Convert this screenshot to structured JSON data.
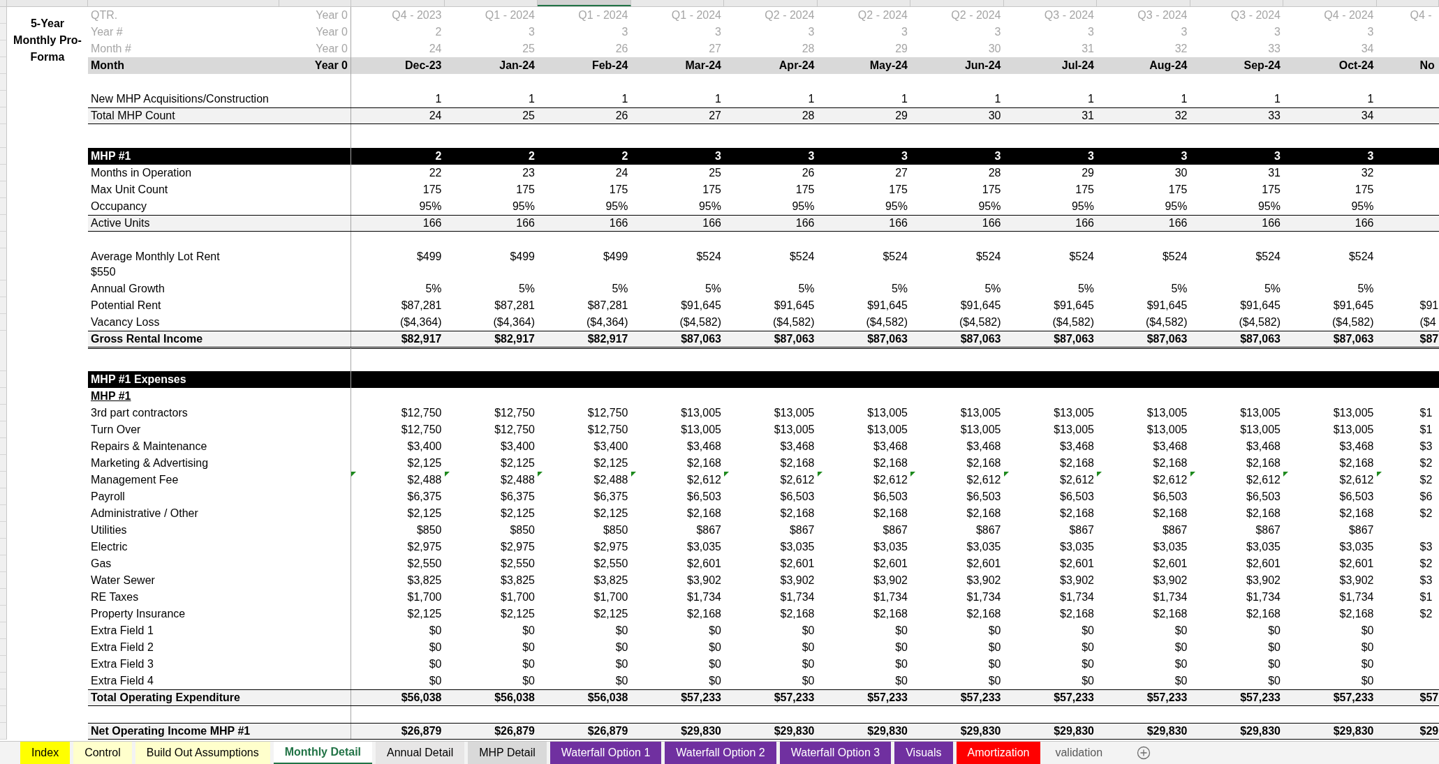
{
  "title_block": "5-Year Monthly Pro-Forma",
  "columns": [
    {
      "selected": false
    },
    {
      "selected": false
    },
    {
      "selected": true
    },
    {
      "selected": false
    },
    {
      "selected": false
    },
    {
      "selected": false
    },
    {
      "selected": false
    },
    {
      "selected": false
    },
    {
      "selected": false
    },
    {
      "selected": false
    },
    {
      "selected": false
    },
    {
      "selected": false
    }
  ],
  "header_rows": [
    {
      "kind": "muted",
      "label": "QTR.",
      "year0": "Year 0",
      "values": [
        "Q4 - 2023",
        "Q1 - 2024",
        "Q1 - 2024",
        "Q1 - 2024",
        "Q2 - 2024",
        "Q2 - 2024",
        "Q2 - 2024",
        "Q3 - 2024",
        "Q3 - 2024",
        "Q3 - 2024",
        "Q4 - 2024"
      ],
      "edge": "Q4 -"
    },
    {
      "kind": "muted",
      "label": "Year #",
      "year0": "Year 0",
      "values": [
        "2",
        "3",
        "3",
        "3",
        "3",
        "3",
        "3",
        "3",
        "3",
        "3",
        "3"
      ]
    },
    {
      "kind": "muted",
      "label": "Month #",
      "year0": "Year 0",
      "values": [
        "24",
        "25",
        "26",
        "27",
        "28",
        "29",
        "30",
        "31",
        "32",
        "33",
        "34"
      ]
    },
    {
      "kind": "heading",
      "label": "Month",
      "year0": "Year 0",
      "values": [
        "Dec-23",
        "Jan-24",
        "Feb-24",
        "Mar-24",
        "Apr-24",
        "May-24",
        "Jun-24",
        "Jul-24",
        "Aug-24",
        "Sep-24",
        "Oct-24"
      ],
      "edge": "No"
    }
  ],
  "rows": [
    {
      "kind": "spacer"
    },
    {
      "kind": "plain",
      "label": "New MHP Acquisitions/Construction",
      "values": [
        "1",
        "1",
        "1",
        "1",
        "1",
        "1",
        "1",
        "1",
        "1",
        "1",
        "1"
      ]
    },
    {
      "kind": "total",
      "label": "Total MHP Count",
      "values": [
        "24",
        "25",
        "26",
        "27",
        "28",
        "29",
        "30",
        "31",
        "32",
        "33",
        "34"
      ]
    },
    {
      "kind": "spacer"
    },
    {
      "kind": "band",
      "label": "MHP #1",
      "values": [
        "2",
        "2",
        "2",
        "3",
        "3",
        "3",
        "3",
        "3",
        "3",
        "3",
        "3"
      ]
    },
    {
      "kind": "plain",
      "label": "Months in Operation",
      "values": [
        "22",
        "23",
        "24",
        "25",
        "26",
        "27",
        "28",
        "29",
        "30",
        "31",
        "32"
      ]
    },
    {
      "kind": "plain",
      "label": "Max Unit Count",
      "values": [
        "175",
        "175",
        "175",
        "175",
        "175",
        "175",
        "175",
        "175",
        "175",
        "175",
        "175"
      ]
    },
    {
      "kind": "plain",
      "label": "Occupancy",
      "values": [
        "95%",
        "95%",
        "95%",
        "95%",
        "95%",
        "95%",
        "95%",
        "95%",
        "95%",
        "95%",
        "95%"
      ]
    },
    {
      "kind": "total",
      "label": "Active Units",
      "values": [
        "166",
        "166",
        "166",
        "166",
        "166",
        "166",
        "166",
        "166",
        "166",
        "166",
        "166"
      ]
    },
    {
      "kind": "spacer"
    },
    {
      "kind": "plain",
      "label": "Average Monthly Lot Rent",
      "note": "$550",
      "values": [
        "$499",
        "$499",
        "$499",
        "$524",
        "$524",
        "$524",
        "$524",
        "$524",
        "$524",
        "$524",
        "$524"
      ]
    },
    {
      "kind": "plain",
      "label": "Annual Growth",
      "values": [
        "5%",
        "5%",
        "5%",
        "5%",
        "5%",
        "5%",
        "5%",
        "5%",
        "5%",
        "5%",
        "5%"
      ]
    },
    {
      "kind": "plain",
      "label": "Potential Rent",
      "values": [
        "$87,281",
        "$87,281",
        "$87,281",
        "$91,645",
        "$91,645",
        "$91,645",
        "$91,645",
        "$91,645",
        "$91,645",
        "$91,645",
        "$91,645"
      ],
      "edge": "$91"
    },
    {
      "kind": "plain",
      "label": "Vacancy Loss",
      "values": [
        "($4,364)",
        "($4,364)",
        "($4,364)",
        "($4,582)",
        "($4,582)",
        "($4,582)",
        "($4,582)",
        "($4,582)",
        "($4,582)",
        "($4,582)",
        "($4,582)"
      ],
      "edge": "($4"
    },
    {
      "kind": "grand",
      "label": "Gross Rental Income",
      "values": [
        "$82,917",
        "$82,917",
        "$82,917",
        "$87,063",
        "$87,063",
        "$87,063",
        "$87,063",
        "$87,063",
        "$87,063",
        "$87,063",
        "$87,063"
      ],
      "edge": "$87"
    },
    {
      "kind": "spacer"
    },
    {
      "kind": "band",
      "label": "MHP #1 Expenses",
      "values": []
    },
    {
      "kind": "subhead",
      "label": "MHP #1",
      "values": []
    },
    {
      "kind": "plain",
      "label": "3rd part contractors",
      "values": [
        "$12,750",
        "$12,750",
        "$12,750",
        "$13,005",
        "$13,005",
        "$13,005",
        "$13,005",
        "$13,005",
        "$13,005",
        "$13,005",
        "$13,005"
      ],
      "edge": "$1"
    },
    {
      "kind": "plain",
      "label": "Turn Over",
      "values": [
        "$12,750",
        "$12,750",
        "$12,750",
        "$13,005",
        "$13,005",
        "$13,005",
        "$13,005",
        "$13,005",
        "$13,005",
        "$13,005",
        "$13,005"
      ],
      "edge": "$1"
    },
    {
      "kind": "plain",
      "label": "Repairs & Maintenance",
      "values": [
        "$3,400",
        "$3,400",
        "$3,400",
        "$3,468",
        "$3,468",
        "$3,468",
        "$3,468",
        "$3,468",
        "$3,468",
        "$3,468",
        "$3,468"
      ],
      "edge": "$3"
    },
    {
      "kind": "plain",
      "label": "Marketing & Advertising",
      "values": [
        "$2,125",
        "$2,125",
        "$2,125",
        "$2,168",
        "$2,168",
        "$2,168",
        "$2,168",
        "$2,168",
        "$2,168",
        "$2,168",
        "$2,168"
      ],
      "edge": "$2"
    },
    {
      "kind": "plain",
      "label": "Management Fee",
      "flagged": true,
      "values": [
        "$2,488",
        "$2,488",
        "$2,488",
        "$2,612",
        "$2,612",
        "$2,612",
        "$2,612",
        "$2,612",
        "$2,612",
        "$2,612",
        "$2,612"
      ],
      "edge": "$2"
    },
    {
      "kind": "plain",
      "label": "Payroll",
      "values": [
        "$6,375",
        "$6,375",
        "$6,375",
        "$6,503",
        "$6,503",
        "$6,503",
        "$6,503",
        "$6,503",
        "$6,503",
        "$6,503",
        "$6,503"
      ],
      "edge": "$6"
    },
    {
      "kind": "plain",
      "label": "Administrative / Other",
      "values": [
        "$2,125",
        "$2,125",
        "$2,125",
        "$2,168",
        "$2,168",
        "$2,168",
        "$2,168",
        "$2,168",
        "$2,168",
        "$2,168",
        "$2,168"
      ],
      "edge": "$2"
    },
    {
      "kind": "plain",
      "label": "Utilities",
      "values": [
        "$850",
        "$850",
        "$850",
        "$867",
        "$867",
        "$867",
        "$867",
        "$867",
        "$867",
        "$867",
        "$867"
      ]
    },
    {
      "kind": "plain",
      "label": "Electric",
      "values": [
        "$2,975",
        "$2,975",
        "$2,975",
        "$3,035",
        "$3,035",
        "$3,035",
        "$3,035",
        "$3,035",
        "$3,035",
        "$3,035",
        "$3,035"
      ],
      "edge": "$3"
    },
    {
      "kind": "plain",
      "label": "Gas",
      "values": [
        "$2,550",
        "$2,550",
        "$2,550",
        "$2,601",
        "$2,601",
        "$2,601",
        "$2,601",
        "$2,601",
        "$2,601",
        "$2,601",
        "$2,601"
      ],
      "edge": "$2"
    },
    {
      "kind": "plain",
      "label": "Water Sewer",
      "values": [
        "$3,825",
        "$3,825",
        "$3,825",
        "$3,902",
        "$3,902",
        "$3,902",
        "$3,902",
        "$3,902",
        "$3,902",
        "$3,902",
        "$3,902"
      ],
      "edge": "$3"
    },
    {
      "kind": "plain",
      "label": "RE Taxes",
      "values": [
        "$1,700",
        "$1,700",
        "$1,700",
        "$1,734",
        "$1,734",
        "$1,734",
        "$1,734",
        "$1,734",
        "$1,734",
        "$1,734",
        "$1,734"
      ],
      "edge": "$1"
    },
    {
      "kind": "plain",
      "label": "Property Insurance",
      "values": [
        "$2,125",
        "$2,125",
        "$2,125",
        "$2,168",
        "$2,168",
        "$2,168",
        "$2,168",
        "$2,168",
        "$2,168",
        "$2,168",
        "$2,168"
      ],
      "edge": "$2"
    },
    {
      "kind": "plain",
      "label": "Extra Field 1",
      "values": [
        "$0",
        "$0",
        "$0",
        "$0",
        "$0",
        "$0",
        "$0",
        "$0",
        "$0",
        "$0",
        "$0"
      ]
    },
    {
      "kind": "plain",
      "label": "Extra Field 2",
      "values": [
        "$0",
        "$0",
        "$0",
        "$0",
        "$0",
        "$0",
        "$0",
        "$0",
        "$0",
        "$0",
        "$0"
      ]
    },
    {
      "kind": "plain",
      "label": "Extra Field 3",
      "values": [
        "$0",
        "$0",
        "$0",
        "$0",
        "$0",
        "$0",
        "$0",
        "$0",
        "$0",
        "$0",
        "$0"
      ]
    },
    {
      "kind": "plain",
      "label": "Extra Field 4",
      "values": [
        "$0",
        "$0",
        "$0",
        "$0",
        "$0",
        "$0",
        "$0",
        "$0",
        "$0",
        "$0",
        "$0"
      ]
    },
    {
      "kind": "summary",
      "label": "Total Operating Expenditure",
      "values": [
        "$56,038",
        "$56,038",
        "$56,038",
        "$57,233",
        "$57,233",
        "$57,233",
        "$57,233",
        "$57,233",
        "$57,233",
        "$57,233",
        "$57,233"
      ],
      "edge": "$57"
    },
    {
      "kind": "spacer"
    },
    {
      "kind": "summary",
      "label": "Net Operating Income MHP #1",
      "values": [
        "$26,879",
        "$26,879",
        "$26,879",
        "$29,830",
        "$29,830",
        "$29,830",
        "$29,830",
        "$29,830",
        "$29,830",
        "$29,830",
        "$29,830"
      ],
      "edge": "$29"
    }
  ],
  "sheet_tabs": [
    {
      "label": "Index",
      "selected": false,
      "color": "#ffff00"
    },
    {
      "label": "Control",
      "selected": false,
      "color": "#ffffcc"
    },
    {
      "label": "Build Out Assumptions",
      "selected": false,
      "color": "#ffffcc"
    },
    {
      "label": "Monthly Detail",
      "selected": true
    },
    {
      "label": "Annual Detail",
      "selected": false,
      "color": "#e7e6e6"
    },
    {
      "label": "MHP Detail",
      "selected": false,
      "color": "#d9d9d9"
    },
    {
      "label": "Waterfall Option 1",
      "selected": false,
      "color": "#7030a0"
    },
    {
      "label": "Waterfall Option 2",
      "selected": false,
      "color": "#7030a0"
    },
    {
      "label": "Waterfall Option 3",
      "selected": false,
      "color": "#7030a0"
    },
    {
      "label": "Visuals",
      "selected": false,
      "color": "#7030a0"
    },
    {
      "label": "Amortization",
      "selected": false,
      "color": "#ff0000"
    },
    {
      "label": "validation",
      "selected": false
    }
  ]
}
